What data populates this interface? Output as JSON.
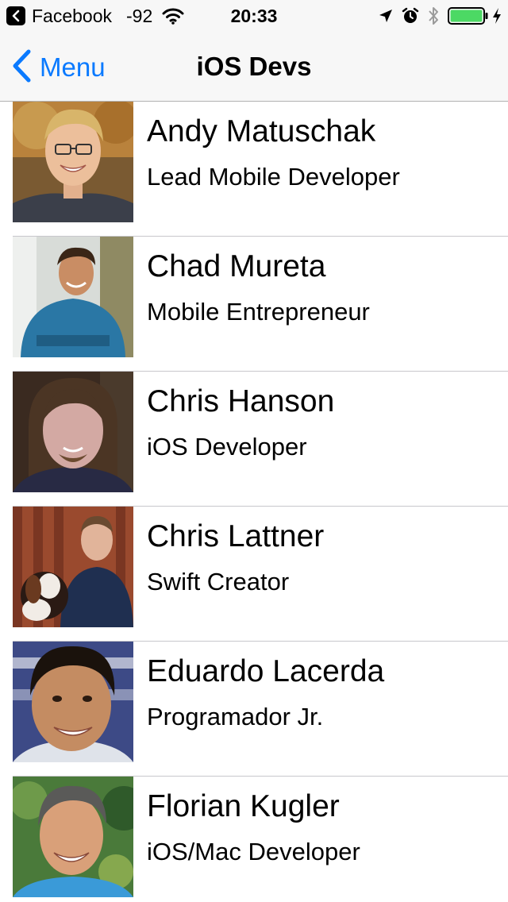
{
  "status_bar": {
    "back_app": "Facebook",
    "signal": "-92",
    "time": "20:33",
    "icons": [
      "location-arrow-icon",
      "alarm-icon",
      "bluetooth-icon",
      "battery-icon",
      "charging-bolt-icon"
    ],
    "battery_level": 1.0,
    "battery_color": "#4cd964"
  },
  "nav": {
    "back_label": "Menu",
    "title": "iOS Devs",
    "tint_color": "#0a7aff"
  },
  "developers": [
    {
      "name": "Andy Matuschak",
      "role": "Lead Mobile Developer"
    },
    {
      "name": "Chad Mureta",
      "role": "Mobile Entrepreneur"
    },
    {
      "name": "Chris Hanson",
      "role": "iOS Developer"
    },
    {
      "name": "Chris Lattner",
      "role": "Swift Creator"
    },
    {
      "name": "Eduardo Lacerda",
      "role": "Programador Jr."
    },
    {
      "name": "Florian Kugler",
      "role": "iOS/Mac Developer"
    }
  ]
}
